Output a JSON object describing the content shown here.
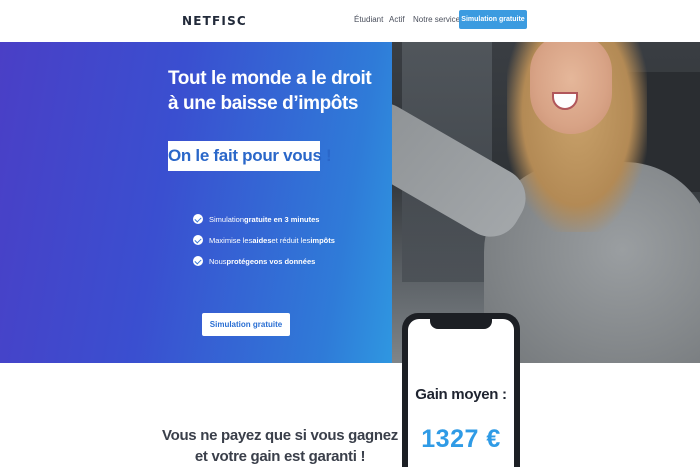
{
  "header": {
    "logo": "NETFISC",
    "nav": [
      "Étudiant",
      "Actif",
      "Notre service"
    ],
    "cta_label": "Simulation gratuite"
  },
  "hero": {
    "title_line1": "Tout le monde a le droit",
    "title_line2": "à une baisse d’impôts",
    "badge": "On le fait pour vous !",
    "features": [
      {
        "before": "Simulation ",
        "bold": "gratuite en 3 minutes",
        "after": ""
      },
      {
        "before": "Maximise les ",
        "bold": "aides",
        "after": " et réduit les ",
        "bold2": "impôts"
      },
      {
        "before": "Nous ",
        "bold": "protégeons vos données",
        "after": ""
      }
    ],
    "cta_label": "Simulation gratuite"
  },
  "section": {
    "title_line1": "Vous ne payez que si vous gagnez",
    "title_line2": "et votre gain est garanti !"
  },
  "phone": {
    "label": "Gain moyen :",
    "value": "1327 €"
  },
  "colors": {
    "accent": "#3b9be0",
    "gradient_start": "#4a3fc6",
    "gradient_end": "#2b9ee6",
    "phone_value": "#2f9be6"
  }
}
